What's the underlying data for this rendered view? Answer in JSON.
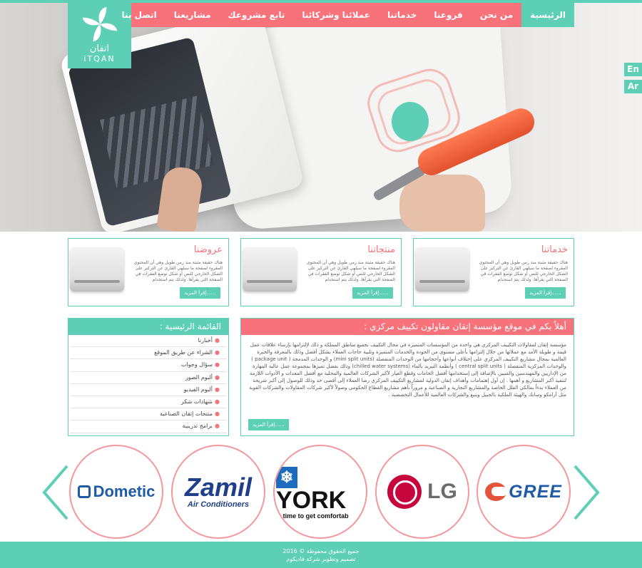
{
  "logo": {
    "arabic": "اتقان",
    "latin": "iTQAN"
  },
  "nav": {
    "items": [
      {
        "label": "الرئيسية",
        "active": true
      },
      {
        "label": "من نحن",
        "active": false
      },
      {
        "label": "فروعنا",
        "active": false
      },
      {
        "label": "خدماتنا",
        "active": false
      },
      {
        "label": "عملائنا وشركائنا",
        "active": false
      },
      {
        "label": "تابع مشروعك",
        "active": false
      },
      {
        "label": "مشاريعنا",
        "active": false
      },
      {
        "label": "اتصل بنا",
        "active": false
      }
    ]
  },
  "lang": {
    "en": "En",
    "ar": "Ar"
  },
  "cards": [
    {
      "title": "خدماتنا",
      "text": "هناك حقيقة مثبتة منذ زمن طويل وهي أن المحتوى المقروء لصفحة ما سيلهي القارئ عن التركيز على الشكل الخارجي للنص أو شكل توضع الفقرات في الصفحة التي يقرأها. ولذلك يتم استخدام",
      "button": "إقرأ المزيد......"
    },
    {
      "title": "منتجاتنا",
      "text": "هناك حقيقة مثبتة منذ زمن طويل وهي أن المحتوى المقروء لصفحة ما سيلهي القارئ عن التركيز على الشكل الخارجي للنص أو شكل توضع الفقرات في الصفحة التي يقرأها. ولذلك يتم استخدام",
      "button": "إقرأ المزيد......"
    },
    {
      "title": "عروضنا",
      "text": "هناك حقيقة مثبتة منذ زمن طويل وهي أن المحتوى المقروء لصفحة ما سيلهي القارئ عن التركيز على الشكل الخارجي للنص أو شكل توضع الفقرات في الصفحة التي يقرأها. ولذلك يتم استخدام",
      "button": "إقرأ المزيد......"
    }
  ],
  "sidebar": {
    "title": "القائمة الرئيسية :",
    "items": [
      "أخبارنا",
      "الشراء عن طريق الموقع",
      "سؤال وجواب",
      "ألبوم الصور",
      "ألبوم الفيديو",
      "شهادات شكر",
      "منتجات إتقان الصناعية",
      "برامج تدريبية"
    ]
  },
  "welcome": {
    "title": "أهلاً بكم في موقع مؤسسة إتقان مقاولون تكييف مركزي :",
    "body": "مؤسسة إتقان لمقاولات التكييف المركزي هي واحدة من المؤسسات المتميزة في مجال التكييف بجميع مناطق المملكة و ذلك لإلتزامها بإرساء علاقات عمل قيمة و طويلة الأمد مع عملائها من خلال إلتزامها بأعلى مستوى من الجودة والخدمات المتميزة وتلبية حاجات العملاء بشكل أفضل وذلك بالمعرفة والخبرة العالمية بمجال مشاريع التكييف المركزي على إختلاف أنواعها وأحجامها من الوحدات المنفصلة (mini split units) و الوحدات المدمجة ( package unit ) والوحدات المركزية المنفصلة ( central split units ) وأنظمة التبريد بالماء (chilled water systems) وذلك بفضل تميزها بمجموعة عمل عالية المهارة من الإداريين والمهندسين والفنيين بالإضافة إلى إستخدامها أفضل الخامات وقطع الغيار لأكبر الشركات العالمية والمحلية مع أفضل المعدات و الأدوات اللازمة لتنفيذ أكبر المشاريع و أهمها . إن أول إهتمامات وأهداف إتقان الدولية لمشاريع التكييف المركزي رضا العملاء إلى أقصى حد وذلك للوصول إلى أكبر شريحة من العملاء بدءاً بمالكي الفلل الخاصة والمشاريع التجارية و الصناعية و مروراً بأهم مشاريع القطاع الحكومي وصولاً لأكبر شركات المقاولات والشركات القوية مثل أرامكو وسابك والهيئة الملكية بالجبيل وينبع والشركات العالمية للأعمال التخصصية .",
    "button": "إقرأ المزيد......"
  },
  "brands": [
    {
      "name": "Dometic"
    },
    {
      "name": "Zamil",
      "tagline": "Air Conditioners"
    },
    {
      "name": "YORK",
      "tagline": "'s time to get comfortab"
    },
    {
      "name": "LG"
    },
    {
      "name": "GREE"
    }
  ],
  "footer": {
    "line1": "جميع الحقوق محفوظة © 2016",
    "line2": "تصميم وتطوير شركة فاديكوم"
  },
  "colors": {
    "teal": "#5ccfb5",
    "pink": "#f7727a"
  }
}
